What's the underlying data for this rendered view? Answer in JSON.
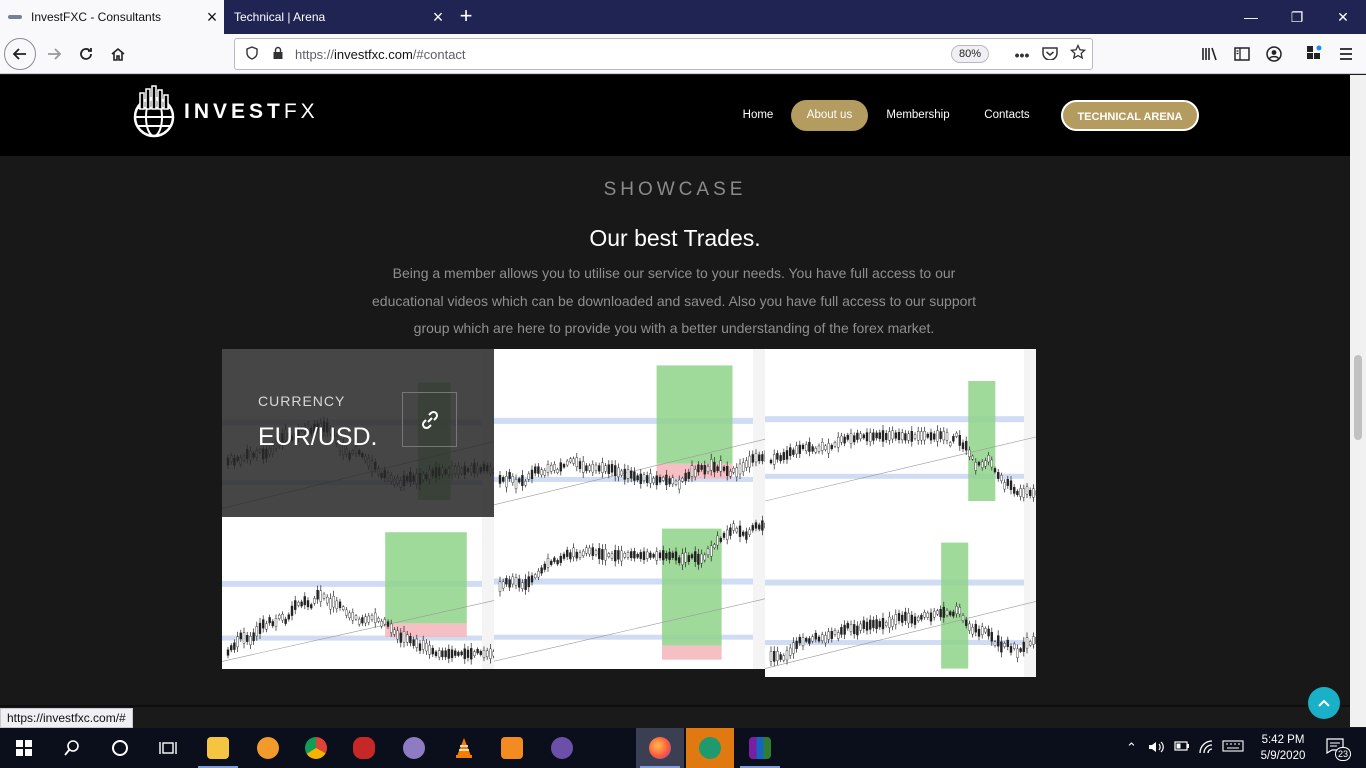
{
  "browser": {
    "tabs": [
      {
        "label": "InvestFXC - Consultants",
        "active": true
      },
      {
        "label": "Technical | Arena",
        "active": false
      }
    ],
    "url_prefix": "https://",
    "url_host": "investfxc.com",
    "url_path": "/#contact",
    "zoom": "80%",
    "status_url": "https://investfxc.com/#"
  },
  "site": {
    "logo_text_bold": "INVEST",
    "logo_text_light": "FX",
    "menu": {
      "home": "Home",
      "about": "About us",
      "membership": "Membership",
      "contacts": "Contacts",
      "arena": "TECHNICAL ARENA"
    },
    "accent_color": "#b49b5f"
  },
  "showcase": {
    "kicker": "SHOWCASE",
    "title": "Our best Trades.",
    "description": "Being a member allows you to utilise our service to your needs. You have full access to our educational videos which can be downloaded and saved. Also you have full access to our support group which are here to provide you with a better understanding of the forex market.",
    "hover_item": {
      "category": "CURRENCY",
      "name": "EUR/USD."
    }
  },
  "taskbar": {
    "time": "5:42 PM",
    "date": "5/9/2020",
    "notification_count": "23"
  },
  "icons": [
    "back-icon",
    "forward-icon",
    "reload-icon",
    "home-icon",
    "shield-icon",
    "lock-icon",
    "more-icon",
    "pocket-icon",
    "star-icon",
    "library-icon",
    "sidebar-icon",
    "account-icon",
    "extensions-icon",
    "menu-icon",
    "link-icon",
    "chevron-up-icon"
  ]
}
